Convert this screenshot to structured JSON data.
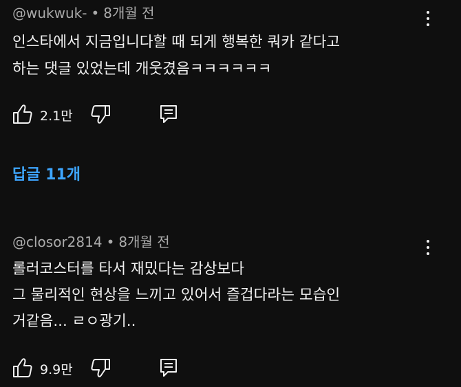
{
  "comments": [
    {
      "author": "@wukwuk-",
      "separator": "•",
      "time": "8개월 전",
      "text_lines": [
        "인스타에서 지금입니다할 때 되게 행복한 쿼카 같다고",
        "하는 댓글 있었는데 개웃겼음ㅋㅋㅋㅋㅋㅋ"
      ],
      "likes": "2.1만",
      "replies_label": "답글 11개",
      "icons": {
        "like": "thumbs-up-icon",
        "dislike": "thumbs-down-icon",
        "reply": "reply-icon",
        "more": "more-vert-icon"
      }
    },
    {
      "author": "@closor2814",
      "separator": "•",
      "time": "8개월 전",
      "text_lines": [
        "롤러코스터를 타서 재밌다는 감상보다",
        "그 물리적인 현상을 느끼고 있어서 즐겁다라는 모습인",
        "거같음... ㄹㅇ광기.."
      ],
      "likes": "9.9만",
      "icons": {
        "like": "thumbs-up-icon",
        "dislike": "thumbs-down-icon",
        "reply": "reply-icon",
        "more": "more-vert-icon"
      }
    }
  ],
  "colors": {
    "background": "#0f0f0f",
    "text": "#f1f1f1",
    "meta": "#aaaaaa",
    "link": "#3ea6ff"
  }
}
